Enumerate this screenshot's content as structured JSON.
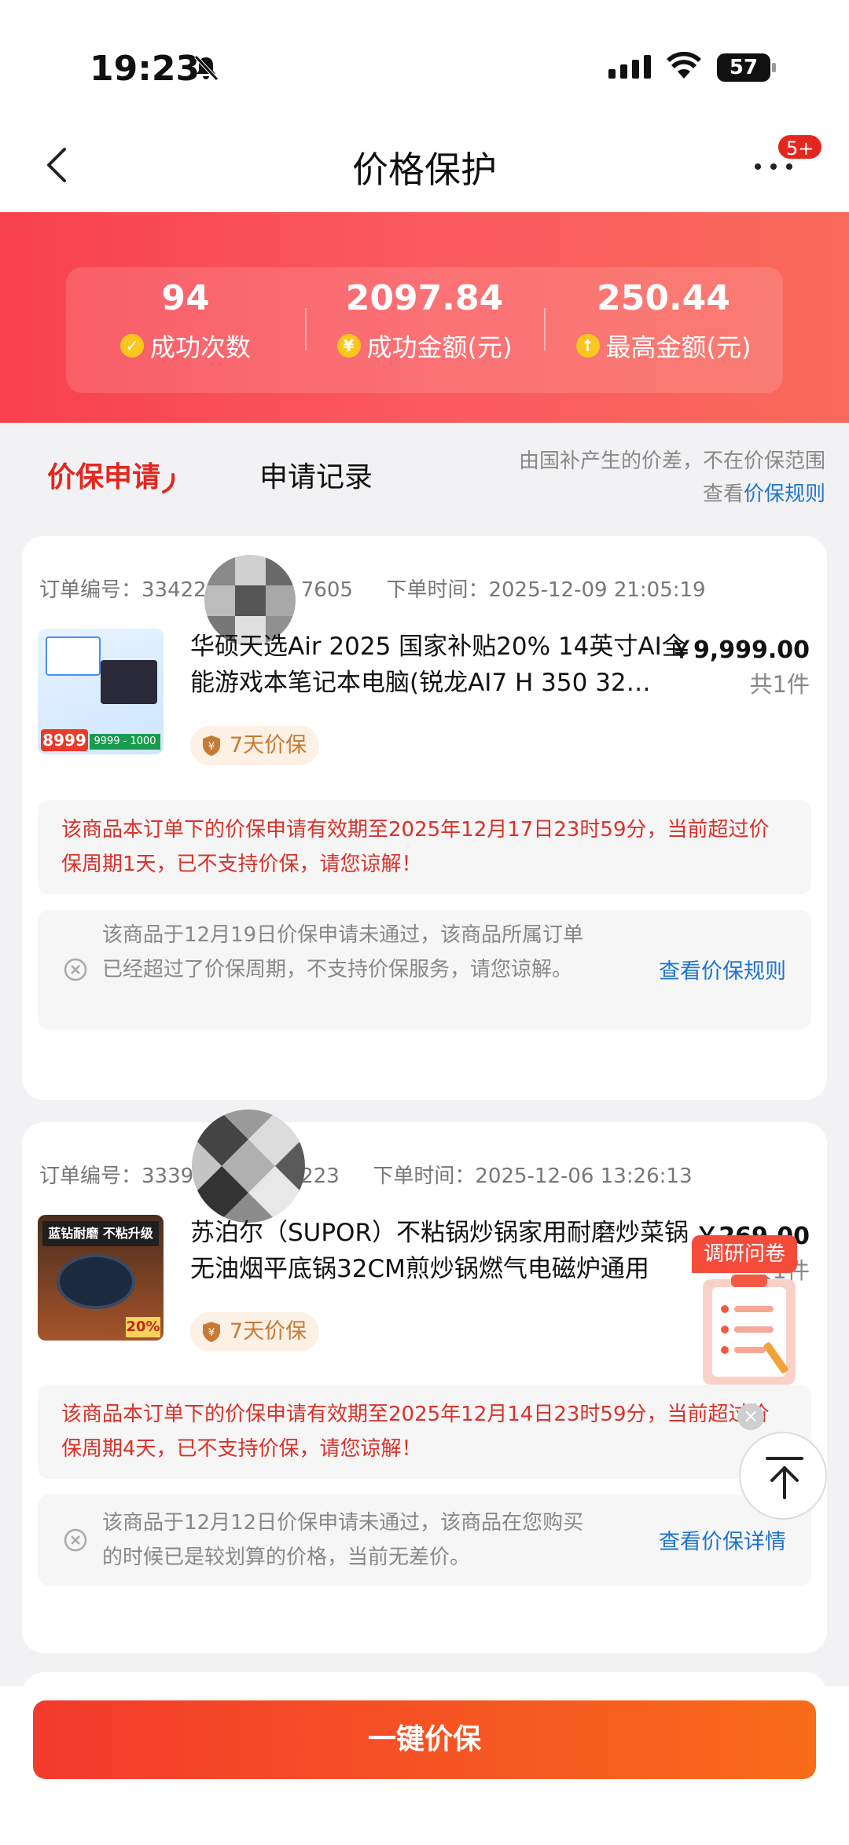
{
  "status_bar": {
    "time": "19:23",
    "battery": "57"
  },
  "nav": {
    "title": "价格保护",
    "more_badge": "5+"
  },
  "stats": [
    {
      "value": "94",
      "label": "成功次数",
      "icon": "check-circle-icon",
      "icon_glyph": "✓"
    },
    {
      "value": "2097.84",
      "label": "成功金额(元)",
      "icon": "yuan-circle-icon",
      "icon_glyph": "¥"
    },
    {
      "value": "250.44",
      "label": "最高金额(元)",
      "icon": "arrow-up-circle-icon",
      "icon_glyph": "↑"
    }
  ],
  "tabs": {
    "active": "价保申请",
    "inactive": "申请记录"
  },
  "notice": {
    "line1": "由国补产生的价差，不在价保范围",
    "prefix": "查看",
    "link": "价保规则"
  },
  "orders": [
    {
      "order_no_label": "订单编号：",
      "order_no_visible_start": "33422",
      "order_no_visible_end": "7605",
      "order_time_label": "下单时间：",
      "order_time": "2025-12-09 21:05:19",
      "title": "华硕天选Air 2025 国家补贴20% 14英寸AI全能游戏本笔记本电脑(锐龙AI7 H 350 32…",
      "price": "￥9,999.00",
      "qty": "共1件",
      "tag": "7天价保",
      "thumb_price_1": "8999",
      "thumb_price_2": "9999 - 1000",
      "warning": "该商品本订单下的价保申请有效期至2025年12月17日23时59分，当前超过价保周期1天，已不支持价保，请您谅解！",
      "fail_text": "该商品于12月19日价保申请未通过，该商品所属订单已经超过了价保周期，不支持价保服务，请您谅解。",
      "fail_link": "查看价保规则"
    },
    {
      "order_no_label": "订单编号：",
      "order_no_visible_start": "3339",
      "order_no_visible_end": "223",
      "order_time_label": "下单时间：",
      "order_time": "2025-12-06 13:26:13",
      "title": "苏泊尔（SUPOR）不粘锅炒锅家用耐磨炒菜锅无油烟平底锅32CM煎炒锅燃气电磁炉通用",
      "price": "￥269.00",
      "qty": "共1件",
      "tag": "7天价保",
      "thumb_top": "蓝钻耐磨 不粘升级",
      "thumb_bottom": "20%",
      "warning": "该商品本订单下的价保申请有效期至2025年12月14日23时59分，当前超过价保周期4天，已不支持价保，请您谅解！",
      "fail_text": "该商品于12月12日价保申请未通过，该商品在您购买的时候已是较划算的价格，当前无差价。",
      "fail_link": "查看价保详情"
    }
  ],
  "floating": {
    "survey_label": "调研问卷"
  },
  "bottom": {
    "button": "一键价保"
  }
}
